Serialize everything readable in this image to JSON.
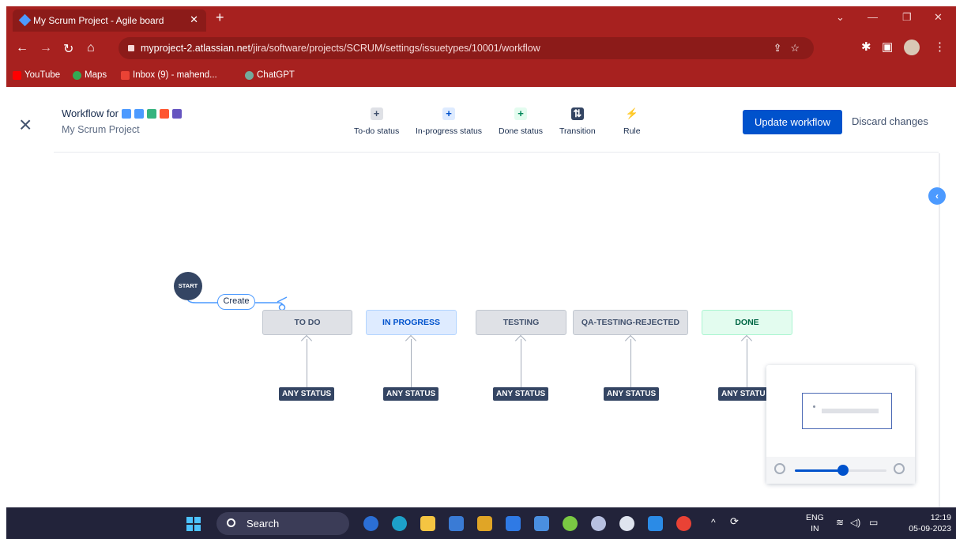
{
  "browser": {
    "tab_title": "My Scrum Project - Agile board",
    "tab_close": "✕",
    "new_tab": "+",
    "url_host": "myproject-2.atlassian.net",
    "url_path": "/jira/software/projects/SCRUM/settings/issuetypes/10001/workflow",
    "bookmarks": [
      "YouTube",
      "Maps",
      "Inbox (9) - mahend...",
      "ChatGPT"
    ]
  },
  "header": {
    "title": "Workflow for",
    "project": "My Scrum Project",
    "close_icon": "×",
    "tools": [
      {
        "label": "To-do status",
        "glyph": "+",
        "color": "#dfe1e6",
        "fg": "#42526e"
      },
      {
        "label": "In-progress status",
        "glyph": "+",
        "color": "#deebff",
        "fg": "#0052cc"
      },
      {
        "label": "Done status",
        "glyph": "+",
        "color": "#e3fcef",
        "fg": "#00875a"
      },
      {
        "label": "Transition",
        "glyph": "⇅",
        "color": "#344563",
        "fg": "#ffffff"
      },
      {
        "label": "Rule",
        "glyph": "⚡",
        "color": "transparent",
        "fg": "#42526e"
      }
    ],
    "update_button": "Update workflow",
    "discard_button": "Discard changes",
    "issue_type_colors": [
      "#4c9aff",
      "#4c9aff",
      "#36b37e",
      "#ff5630",
      "#6554c0"
    ]
  },
  "workflow": {
    "start_label": "START",
    "create_label": "Create",
    "statuses": [
      {
        "name": "TO DO",
        "category": "todo"
      },
      {
        "name": "IN PROGRESS",
        "category": "progress"
      },
      {
        "name": "TESTING",
        "category": "todo"
      },
      {
        "name": "QA-TESTING-REJECTED",
        "category": "todo"
      },
      {
        "name": "DONE",
        "category": "done"
      }
    ],
    "any_status_labels": [
      "ANY STATUS",
      "ANY STATUS",
      "ANY STATUS",
      "ANY STATUS",
      "ANY STATU"
    ]
  },
  "minimap": {
    "zoom_level": 0.53
  },
  "taskbar": {
    "search_label": "Search",
    "lang_top": "ENG",
    "lang_bottom": "IN",
    "time": "12:19",
    "date": "05-09-2023"
  }
}
